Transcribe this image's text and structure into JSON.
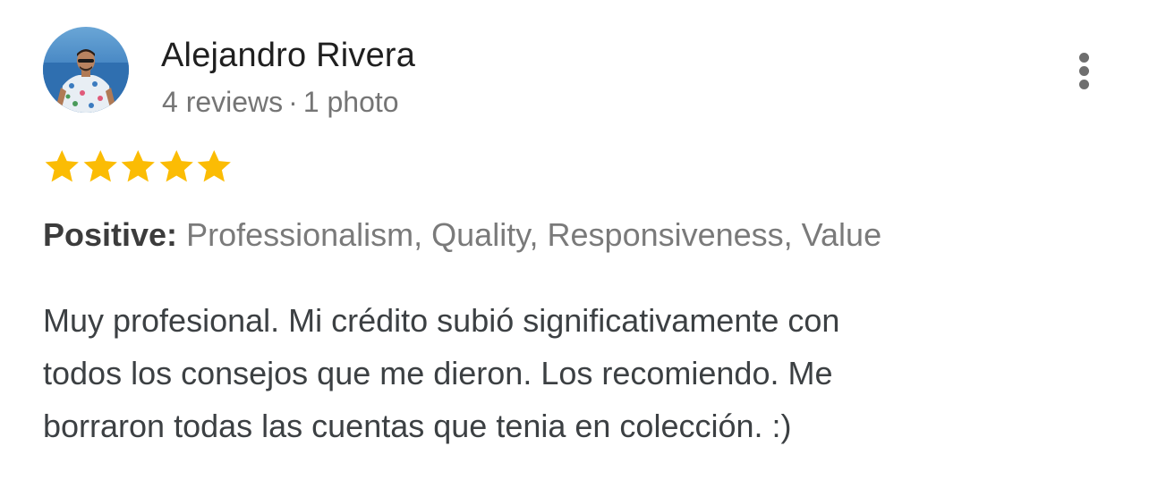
{
  "review": {
    "author": {
      "name": "Alejandro Rivera",
      "reviews_count": "4 reviews",
      "separator": "·",
      "photos_count": "1 photo",
      "avatar_icon": "profile-photo"
    },
    "rating": {
      "value": 5,
      "max": 5,
      "star_color": "#fbbc04"
    },
    "highlights": {
      "label": "Positive:",
      "values": "Professionalism, Quality, Responsiveness, Value"
    },
    "text_lines": [
      "Muy profesional. Mi crédito subió significativamente con",
      "todos los consejos que me dieron. Los recomiendo. Me",
      "borraron todas las cuentas que tenia en colección. :)"
    ],
    "more_icon": "more-vert-icon"
  }
}
